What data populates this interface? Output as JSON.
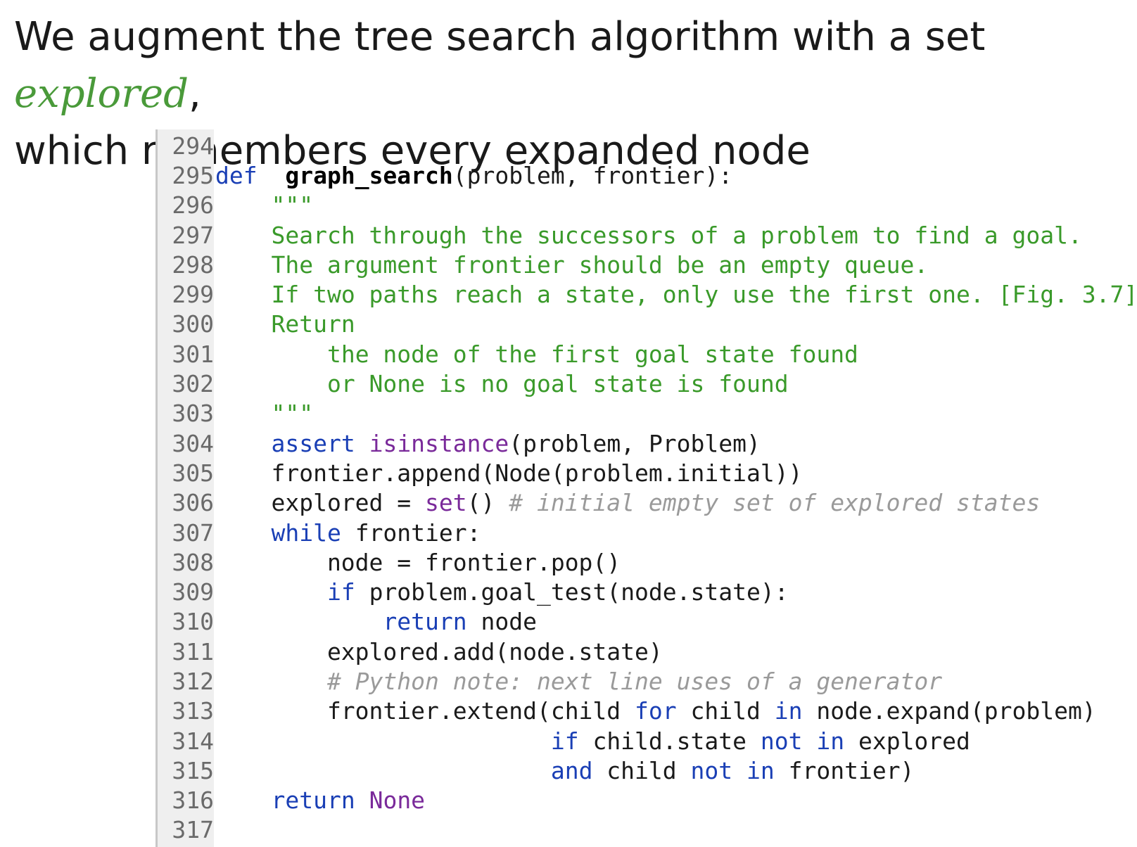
{
  "heading": {
    "text_before": "We augment the tree search algorithm with a set ",
    "emphasis": "explored",
    "text_after": ",",
    "line2": "which remembers every expanded node"
  },
  "code": {
    "lines": [
      {
        "n": "294",
        "tokens": []
      },
      {
        "n": "295",
        "tokens": [
          [
            "kw",
            "def"
          ],
          [
            "",
            "  "
          ],
          [
            "fn",
            "graph_search"
          ],
          [
            "",
            "(problem, frontier):"
          ]
        ]
      },
      {
        "n": "296",
        "tokens": [
          [
            "",
            "    "
          ],
          [
            "str",
            "\"\"\""
          ]
        ]
      },
      {
        "n": "297",
        "tokens": [
          [
            "",
            "    "
          ],
          [
            "str",
            "Search through the successors of a problem to find a goal."
          ]
        ]
      },
      {
        "n": "298",
        "tokens": [
          [
            "",
            "    "
          ],
          [
            "str",
            "The argument frontier should be an empty queue."
          ]
        ]
      },
      {
        "n": "299",
        "tokens": [
          [
            "",
            "    "
          ],
          [
            "str",
            "If two paths reach a state, only use the first one. [Fig. 3.7]"
          ]
        ]
      },
      {
        "n": "300",
        "tokens": [
          [
            "",
            "    "
          ],
          [
            "str",
            "Return"
          ]
        ]
      },
      {
        "n": "301",
        "tokens": [
          [
            "",
            "        "
          ],
          [
            "str",
            "the node of the first goal state found"
          ]
        ]
      },
      {
        "n": "302",
        "tokens": [
          [
            "",
            "        "
          ],
          [
            "str",
            "or None is no goal state is found"
          ]
        ]
      },
      {
        "n": "303",
        "tokens": [
          [
            "",
            "    "
          ],
          [
            "str",
            "\"\"\""
          ]
        ]
      },
      {
        "n": "304",
        "tokens": [
          [
            "",
            "    "
          ],
          [
            "kw",
            "assert"
          ],
          [
            "",
            " "
          ],
          [
            "bi",
            "isinstance"
          ],
          [
            "",
            "(problem, Problem)"
          ]
        ]
      },
      {
        "n": "305",
        "tokens": [
          [
            "",
            "    frontier.append(Node(problem.initial))"
          ]
        ]
      },
      {
        "n": "306",
        "tokens": [
          [
            "",
            "    explored = "
          ],
          [
            "bi",
            "set"
          ],
          [
            "",
            "() "
          ],
          [
            "cm",
            "# initial empty set of explored states"
          ]
        ]
      },
      {
        "n": "307",
        "tokens": [
          [
            "",
            "    "
          ],
          [
            "kw",
            "while"
          ],
          [
            "",
            " frontier:"
          ]
        ]
      },
      {
        "n": "308",
        "tokens": [
          [
            "",
            "        node = frontier.pop()"
          ]
        ]
      },
      {
        "n": "309",
        "tokens": [
          [
            "",
            "        "
          ],
          [
            "kw",
            "if"
          ],
          [
            "",
            " problem.goal_test(node.state):"
          ]
        ]
      },
      {
        "n": "310",
        "tokens": [
          [
            "",
            "            "
          ],
          [
            "kw",
            "return"
          ],
          [
            "",
            " node"
          ]
        ]
      },
      {
        "n": "311",
        "tokens": [
          [
            "",
            "        explored.add(node.state)"
          ]
        ]
      },
      {
        "n": "312",
        "tokens": [
          [
            "",
            "        "
          ],
          [
            "cm",
            "# Python note: next line uses of a generator"
          ]
        ]
      },
      {
        "n": "313",
        "tokens": [
          [
            "",
            "        frontier.extend(child "
          ],
          [
            "kw",
            "for"
          ],
          [
            "",
            " child "
          ],
          [
            "kw",
            "in"
          ],
          [
            "",
            " node.expand(problem)"
          ]
        ]
      },
      {
        "n": "314",
        "tokens": [
          [
            "",
            "                        "
          ],
          [
            "kw",
            "if"
          ],
          [
            "",
            " child.state "
          ],
          [
            "kw",
            "not"
          ],
          [
            "",
            " "
          ],
          [
            "kw",
            "in"
          ],
          [
            "",
            " explored"
          ]
        ]
      },
      {
        "n": "315",
        "tokens": [
          [
            "",
            "                        "
          ],
          [
            "kw",
            "and"
          ],
          [
            "",
            " child "
          ],
          [
            "kw",
            "not"
          ],
          [
            "",
            " "
          ],
          [
            "kw",
            "in"
          ],
          [
            "",
            " frontier)"
          ]
        ]
      },
      {
        "n": "316",
        "tokens": [
          [
            "",
            "    "
          ],
          [
            "kw",
            "return"
          ],
          [
            "",
            " "
          ],
          [
            "bi",
            "None"
          ]
        ]
      },
      {
        "n": "317",
        "tokens": []
      }
    ]
  }
}
